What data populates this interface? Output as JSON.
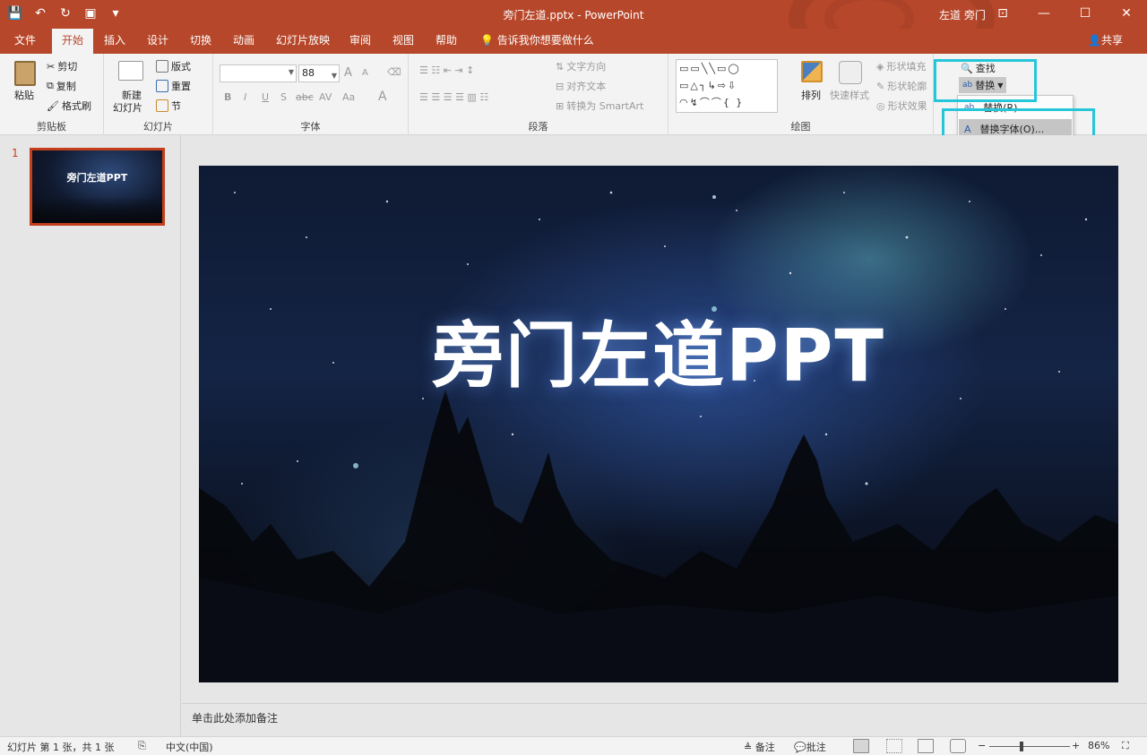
{
  "window": {
    "doc_title": "旁门左道.pptx  -  PowerPoint",
    "user": "左道 旁门",
    "ctrl_minimize": "—",
    "ctrl_restore": "☐",
    "ctrl_close": "✕",
    "ctrl_ribbon_opts": "⊡"
  },
  "qat": {
    "save": "💾",
    "undo": "↶",
    "redo": "↻",
    "present": "▣",
    "more": "▾"
  },
  "tabs": [
    "文件",
    "开始",
    "插入",
    "设计",
    "切换",
    "动画",
    "幻灯片放映",
    "审阅",
    "视图",
    "帮助"
  ],
  "tell_me": "告诉我你想要做什么",
  "share": "共享",
  "ribbon": {
    "clipboard": {
      "paste": "粘贴",
      "cut": "剪切",
      "copy": "复制",
      "format_painter": "格式刷",
      "label": "剪贴板"
    },
    "slides": {
      "new_slide_1": "新建",
      "new_slide_2": "幻灯片",
      "layout": "版式",
      "reset": "重置",
      "section": "节",
      "label": "幻灯片"
    },
    "font": {
      "font_name": "",
      "font_size": "88",
      "bold": "B",
      "italic": "I",
      "underline": "U",
      "shadow": "S",
      "strike": "abc",
      "spacing": "AV",
      "case": "Aa",
      "color": "A",
      "grow": "A",
      "shrink": "A",
      "label": "字体"
    },
    "paragraph": {
      "text_dir": "文字方向",
      "align_text": "对齐文本",
      "smartart": "转换为 SmartArt",
      "label": "段落"
    },
    "drawing": {
      "arrange": "排列",
      "quick_styles": "快速样式",
      "fill": "形状填充",
      "outline": "形状轮廓",
      "effects": "形状效果",
      "label": "绘图"
    },
    "editing": {
      "find": "查找",
      "replace": "替换"
    }
  },
  "replace_menu": {
    "replace_item": "替换(R)...",
    "replace_fonts": "替换字体(O)..."
  },
  "slide_panel": {
    "number": "1",
    "thumb_title": "旁门左道PPT"
  },
  "slide": {
    "title": "旁门左道PPT"
  },
  "notes": "单击此处添加备注",
  "status": {
    "slide_info": "幻灯片 第 1 张，共 1 张",
    "language": "中文(中国)",
    "notes_btn": "备注",
    "comments_btn": "批注",
    "zoom": "86%",
    "zoom_minus": "−",
    "zoom_plus": "+"
  },
  "colors": {
    "accent": "#b7472a",
    "highlight": "#26c6da"
  }
}
